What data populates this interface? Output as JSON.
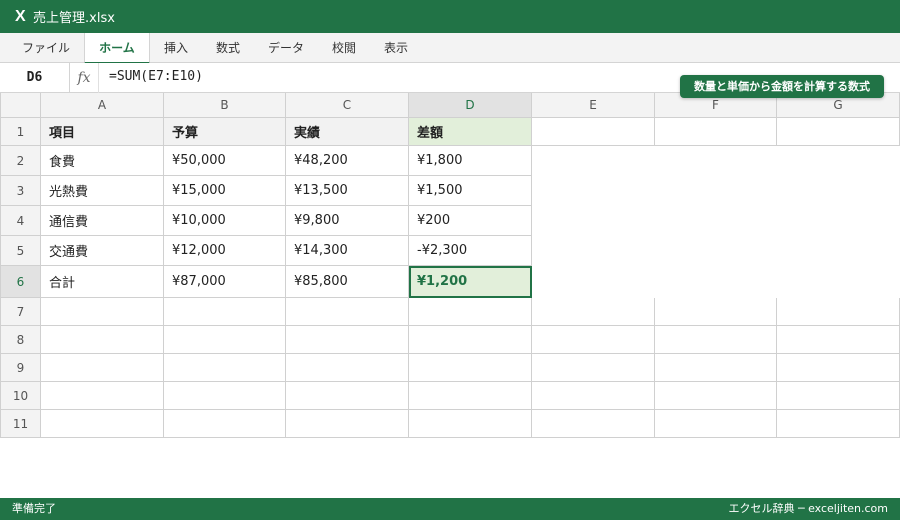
{
  "app": {
    "logo": "X",
    "title": "売上管理.xlsx"
  },
  "ribbon": {
    "tabs": [
      "ファイル",
      "ホーム",
      "挿入",
      "数式",
      "データ",
      "校閲",
      "表示"
    ],
    "active": "ホーム"
  },
  "formula_bar": {
    "cell_ref": "D6",
    "fx": "fx",
    "formula": "=SUM(E7:E10)"
  },
  "callout": "数量と単価から金額を計算する数式",
  "sheet": {
    "columns": [
      "A",
      "B",
      "C",
      "D",
      "E",
      "F",
      "G"
    ],
    "rows": [
      "1",
      "2",
      "3",
      "4",
      "5",
      "6",
      "7",
      "8",
      "9",
      "10",
      "11"
    ],
    "header": [
      "項目",
      "予算",
      "実績",
      "差額"
    ],
    "data": [
      [
        "食費",
        "¥50,000",
        "¥48,200",
        "¥1,800"
      ],
      [
        "光熱費",
        "¥15,000",
        "¥13,500",
        "¥1,500"
      ],
      [
        "通信費",
        "¥10,000",
        "¥9,800",
        "¥200"
      ],
      [
        "交通費",
        "¥12,000",
        "¥14,300",
        "-¥2,300"
      ],
      [
        "合計",
        "¥87,000",
        "¥85,800",
        "¥1,200"
      ]
    ],
    "selected_cell": "D6"
  },
  "status_bar": {
    "left": "準備完了",
    "right": "エクセル辞典 ─ exceljiten.com"
  },
  "colors": {
    "brand": "#217346",
    "selection_fill": "#e2efda"
  }
}
